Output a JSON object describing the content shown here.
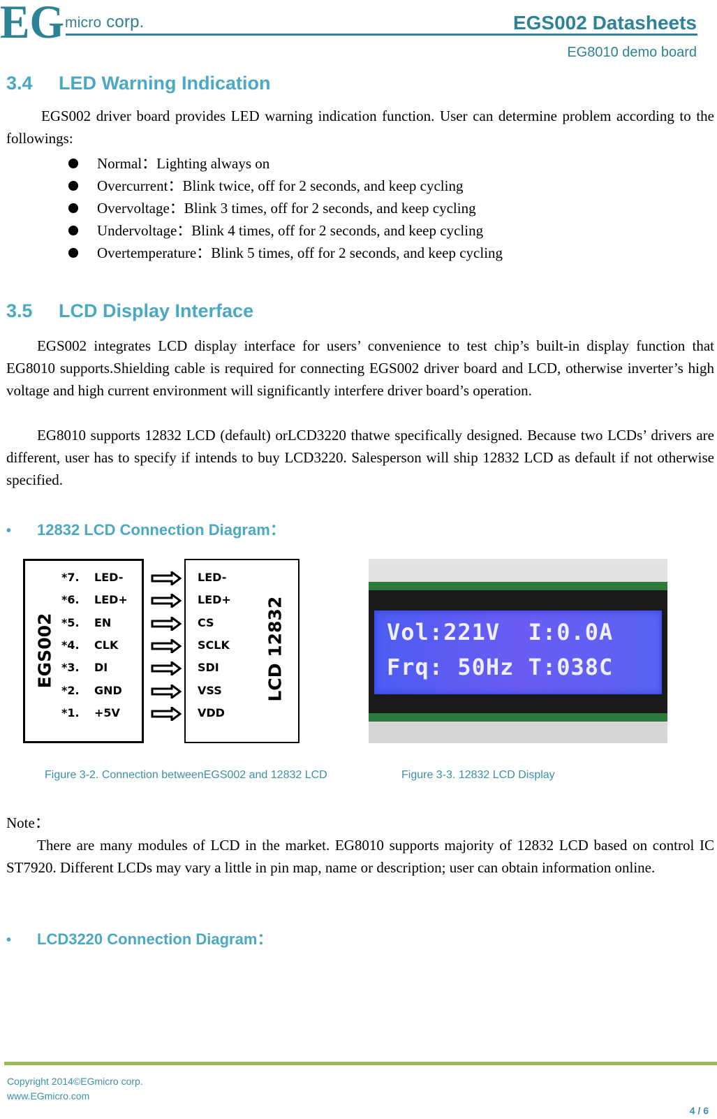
{
  "header": {
    "logo_letters": "EG",
    "company_micro": "micro",
    "company_corp": " corp.",
    "doc_title": "EGS002 Datasheets",
    "doc_subtitle": "EG8010 demo board"
  },
  "section_34": {
    "number": "3.4",
    "title": "LED Warning Indication",
    "intro": "EGS002 driver board provides LED warning indication function. User can determine problem according to the followings:",
    "items": [
      "Normal：Lighting always on",
      "Overcurrent：Blink twice, off for 2 seconds, and keep cycling",
      "Overvoltage：Blink 3 times, off for 2 seconds, and keep cycling",
      "Undervoltage：Blink 4 times, off for 2 seconds, and keep cycling",
      "Overtemperature：Blink 5 times, off for 2 seconds, and keep cycling"
    ]
  },
  "section_35": {
    "number": "3.5",
    "title": "LCD Display Interface",
    "para1": "EGS002 integrates LCD display interface for users’ convenience to test chip’s built-in display function that EG8010 supports.Shielding cable is required for connecting EGS002 driver board and LCD, otherwise inverter’s high voltage and high current environment will significantly interfere driver board’s operation.",
    "para2": "EG8010 supports 12832 LCD (default) orLCD3220 thatwe specifically designed. Because two LCDs’ drivers are different, user has to specify if intends to buy LCD3220. Salesperson will ship 12832 LCD as default if not otherwise specified.",
    "subheading_12832": "12832 LCD Connection Diagram：",
    "diagram": {
      "left_label": "EGS002",
      "right_label": "LCD 12832",
      "pins": [
        {
          "num": "*7.",
          "name": "LED-",
          "lcd": "LED-"
        },
        {
          "num": "*6.",
          "name": "LED+",
          "lcd": "LED+"
        },
        {
          "num": "*5.",
          "name": "EN",
          "lcd": "CS"
        },
        {
          "num": "*4.",
          "name": "CLK",
          "lcd": "SCLK"
        },
        {
          "num": "*3.",
          "name": "DI",
          "lcd": "SDI"
        },
        {
          "num": "*2.",
          "name": "GND",
          "lcd": "VSS"
        },
        {
          "num": "*1.",
          "name": "+5V",
          "lcd": "VDD"
        }
      ]
    },
    "lcd_photo": {
      "line1": "Vol:221V  I:0.0A",
      "line2": "Frq: 50Hz T:038C"
    },
    "caption_left": "Figure 3-2. Connection betweenEGS002 and 12832 LCD",
    "caption_right": "Figure 3-3. 12832 LCD Display",
    "note_label": "Note：",
    "note_text": "There are many modules of LCD in the market. EG8010 supports majority of 12832 LCD based on control IC ST7920. Different LCDs may vary a little in pin map, name or description; user can obtain information online.",
    "subheading_3220": "LCD3220 Connection Diagram："
  },
  "footer": {
    "copyright": "Copyright 2014©EGmicro corp.",
    "website": "www.EGmicro.com",
    "page": "4 / 6"
  },
  "colors": {
    "brand_teal": "#2e8296",
    "heading_blue": "#4aa8c2",
    "footer_green": "#9bbb59"
  }
}
